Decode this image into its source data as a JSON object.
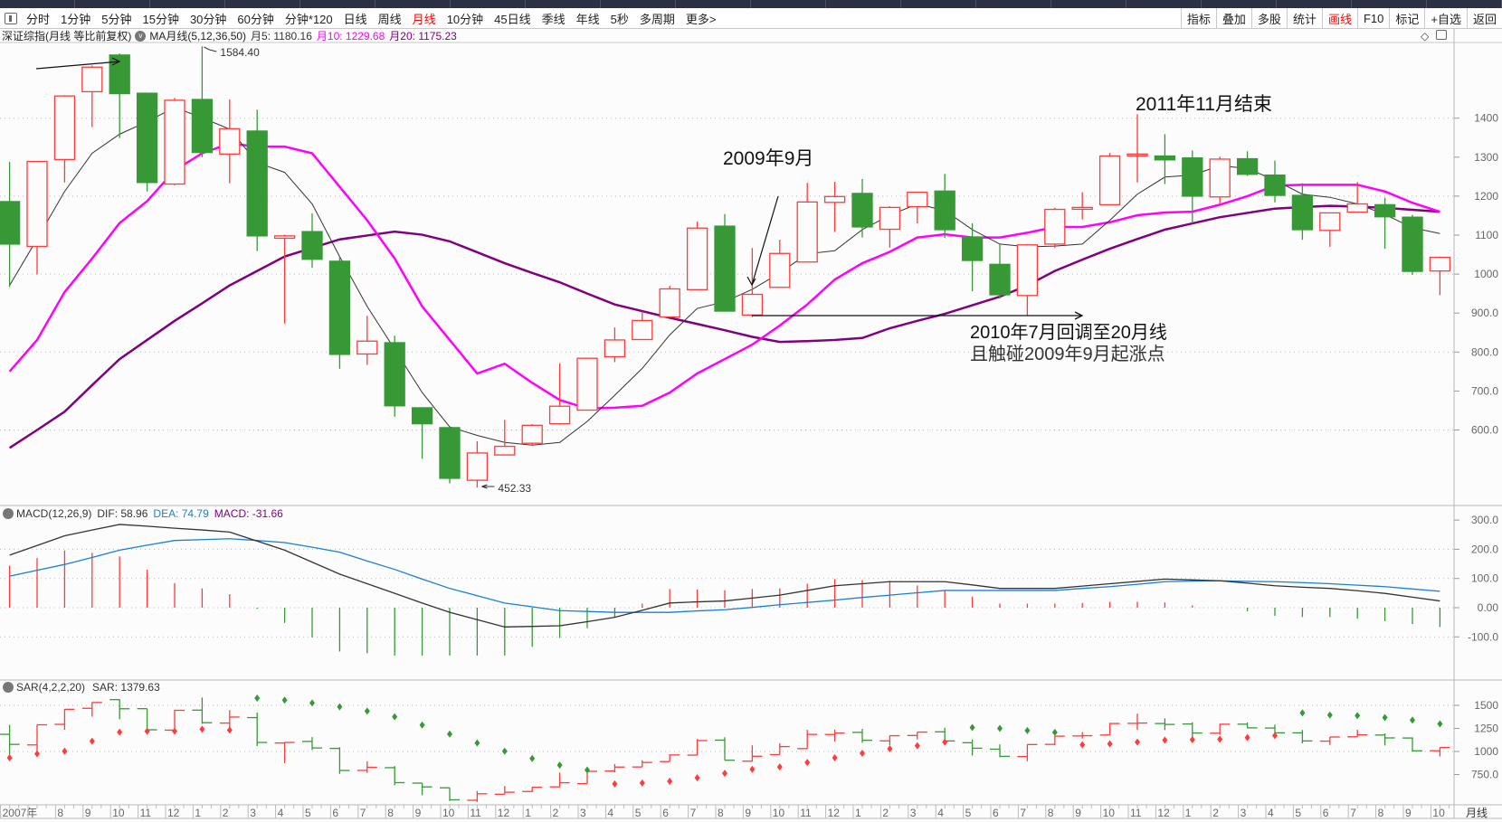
{
  "toolbar": {
    "periods": [
      "分时",
      "1分钟",
      "5分钟",
      "15分钟",
      "30分钟",
      "60分钟",
      "分钟*120",
      "日线",
      "周线",
      "月线",
      "10分钟",
      "45日线",
      "季线",
      "年线",
      "5秒",
      "多周期",
      "更多>"
    ],
    "active_period": "月线",
    "right_buttons": [
      "指标",
      "叠加",
      "多股",
      "统计",
      "画线",
      "F10",
      "标记",
      "+自选",
      "返回"
    ],
    "active_right": "画线"
  },
  "header": {
    "title": "深证综指(月线 等比前复权)",
    "ma_label": "MA月线(5,12,36,50)",
    "ma5": "月5: 1180.16",
    "ma10": "月10: 1229.68",
    "ma20": "月20: 1175.23",
    "diamond_icon": "◇"
  },
  "colors": {
    "up": "#ff3b3b",
    "down": "#369936",
    "ma5": "#333333",
    "ma10": "#ff00ff",
    "ma20": "#800080",
    "dif": "#333333",
    "dea": "#1a7fd4",
    "macd_label": "#800080"
  },
  "chart_data": {
    "type": "candlestick",
    "title": "深证综指(月线 等比前复权)",
    "x_start": "2007-06",
    "x_labels": [
      "2007年",
      "",
      "8",
      "9",
      "10",
      "11",
      "12",
      "1",
      "2",
      "3",
      "4",
      "5",
      "6",
      "7",
      "8",
      "9",
      "10",
      "11",
      "12",
      "1",
      "2",
      "3",
      "4",
      "5",
      "6",
      "7",
      "8",
      "9",
      "10",
      "11",
      "12",
      "1",
      "2",
      "3",
      "4",
      "5",
      "6",
      "7",
      "8",
      "9",
      "10",
      "11",
      "12",
      "1",
      "2",
      "3",
      "4",
      "5",
      "6",
      "7",
      "8",
      "9",
      "10"
    ],
    "period_label": "月线",
    "price_axis": {
      "ticks": [
        "1400",
        "1300",
        "1200",
        "1100",
        "1000",
        "900.0",
        "800.0",
        "700.0",
        "600.0"
      ],
      "values": [
        1400,
        1300,
        1200,
        1100,
        1000,
        900,
        800,
        700,
        600
      ]
    },
    "ohlc": [
      [
        1186,
        1288,
        967,
        1077
      ],
      [
        1071,
        1290,
        999,
        1289
      ],
      [
        1294,
        1459,
        1235,
        1457
      ],
      [
        1468,
        1535,
        1377,
        1531
      ],
      [
        1562,
        1566,
        1349,
        1463
      ],
      [
        1464,
        1464,
        1212,
        1235
      ],
      [
        1231,
        1452,
        1228,
        1446
      ],
      [
        1448,
        1584.4,
        1300,
        1312
      ],
      [
        1308,
        1448,
        1233,
        1373
      ],
      [
        1367,
        1422,
        1059,
        1098
      ],
      [
        1092,
        1101,
        873,
        1098
      ],
      [
        1109,
        1156,
        1016,
        1038
      ],
      [
        1033,
        1046,
        757,
        794
      ],
      [
        795,
        893,
        767,
        828
      ],
      [
        824,
        842,
        634,
        662
      ],
      [
        657,
        657,
        526,
        616
      ],
      [
        606,
        607,
        463,
        476
      ],
      [
        471,
        571,
        452.33,
        541
      ],
      [
        536,
        626,
        536,
        558
      ],
      [
        566,
        615,
        560,
        612
      ],
      [
        616,
        771,
        614,
        661
      ],
      [
        651,
        784,
        651,
        784
      ],
      [
        788,
        863,
        774,
        831
      ],
      [
        832,
        904,
        832,
        881
      ],
      [
        890,
        970,
        890,
        962
      ],
      [
        960,
        1135,
        960,
        1118
      ],
      [
        1123,
        1154,
        905,
        905
      ],
      [
        895,
        1067,
        890,
        948
      ],
      [
        966,
        1088,
        966,
        1053
      ],
      [
        1031,
        1234,
        1030,
        1185
      ],
      [
        1184,
        1237,
        1108,
        1199
      ],
      [
        1207,
        1244,
        1094,
        1121
      ],
      [
        1115,
        1174,
        1068,
        1171
      ],
      [
        1173,
        1210,
        1130,
        1210
      ],
      [
        1213,
        1257,
        1093,
        1114
      ],
      [
        1095,
        1130,
        956,
        1035
      ],
      [
        1025,
        1077,
        937,
        947
      ],
      [
        945,
        1075,
        894,
        1075
      ],
      [
        1077,
        1170,
        1067,
        1166
      ],
      [
        1168,
        1210,
        1140,
        1171
      ],
      [
        1178,
        1311,
        1178,
        1303
      ],
      [
        1305,
        1410,
        1235,
        1308
      ],
      [
        1303,
        1359,
        1231,
        1293
      ],
      [
        1298,
        1317,
        1130,
        1200
      ],
      [
        1198,
        1301,
        1181,
        1295
      ],
      [
        1296,
        1315,
        1252,
        1256
      ],
      [
        1254,
        1291,
        1184,
        1202
      ],
      [
        1202,
        1233,
        1088,
        1114
      ],
      [
        1112,
        1157,
        1070,
        1157
      ],
      [
        1159,
        1236,
        1159,
        1180
      ],
      [
        1178,
        1196,
        1065,
        1147
      ],
      [
        1146,
        1152,
        998,
        1007
      ],
      [
        1008,
        1045,
        946,
        1043
      ]
    ],
    "high_label": "1584.40",
    "low_label": "452.33",
    "ma5": [
      971,
      1090,
      1212,
      1310,
      1359,
      1391,
      1428,
      1401,
      1372,
      1286,
      1261,
      1180,
      1045,
      917,
      807,
      696,
      608,
      586,
      568,
      561,
      568,
      622,
      689,
      758,
      844,
      912,
      929,
      961,
      1003,
      1052,
      1060,
      1114,
      1151,
      1180,
      1163,
      1114,
      1077,
      1070,
      1072,
      1077,
      1138,
      1205,
      1249,
      1254,
      1278,
      1271,
      1241,
      1205,
      1197,
      1180,
      1153,
      1119,
      1104
    ],
    "ma10": [
      750,
      831,
      954,
      1040,
      1131,
      1187,
      1266,
      1310,
      1335,
      1327,
      1327,
      1310,
      1224,
      1138,
      1040,
      917,
      831,
      745,
      770,
      721,
      677,
      655,
      657,
      662,
      696,
      745,
      782,
      819,
      868,
      922,
      986,
      1028,
      1057,
      1094,
      1102,
      1094,
      1094,
      1106,
      1121,
      1121,
      1133,
      1151,
      1158,
      1160,
      1178,
      1200,
      1227,
      1229,
      1229,
      1229,
      1212,
      1183,
      1160
    ],
    "ma20": [
      554,
      600,
      647,
      715,
      782,
      831,
      880,
      925,
      971,
      1008,
      1045,
      1067,
      1089,
      1099,
      1109,
      1101,
      1084,
      1056,
      1028,
      1003,
      979,
      950,
      922,
      905,
      888,
      872,
      856,
      839,
      826,
      828,
      831,
      836,
      861,
      880,
      898,
      920,
      942,
      971,
      1008,
      1037,
      1065,
      1090,
      1114,
      1130,
      1146,
      1157,
      1168,
      1172,
      1175,
      1173,
      1170,
      1165,
      1160
    ],
    "macd": {
      "label": "MACD(12,26,9)",
      "dif_label": "DIF: 58.96",
      "dea_label": "DEA: 74.79",
      "macd_label": "MACD: -31.66",
      "axis_ticks": [
        "300.0",
        "200.0",
        "100.0",
        "0.00",
        "-100.0"
      ],
      "axis_values": [
        300,
        200,
        100,
        0,
        -100
      ],
      "dif": [
        180,
        213,
        246,
        266,
        285,
        279,
        272,
        266,
        259,
        228,
        197,
        156,
        115,
        82,
        49,
        16,
        -16,
        -41,
        -66,
        -64,
        -62,
        -48,
        -33,
        -9,
        16,
        20,
        23,
        33,
        43,
        59,
        75,
        82,
        89,
        89,
        89,
        78,
        66,
        66,
        66,
        74,
        82,
        90,
        98,
        95,
        92,
        84,
        75,
        70,
        66,
        58,
        49,
        36,
        23
      ],
      "dea": [
        108,
        128,
        148,
        172,
        197,
        214,
        230,
        233,
        236,
        230,
        223,
        207,
        190,
        160,
        131,
        98,
        66,
        41,
        16,
        3,
        -10,
        -13,
        -16,
        -16,
        -16,
        -11,
        -7,
        1,
        10,
        18,
        26,
        35,
        43,
        51,
        59,
        59,
        59,
        59,
        59,
        66,
        72,
        80,
        89,
        91,
        92,
        90,
        89,
        86,
        82,
        77,
        72,
        64,
        56
      ]
    },
    "sar": {
      "label": "SAR(4,2,2,20)",
      "value_label": "SAR: 1379.63",
      "axis_ticks": [
        "1500",
        "1250",
        "1000",
        "750.0"
      ],
      "axis_values": [
        1500,
        1250,
        1000,
        750
      ],
      "values": [
        931,
        974,
        1003,
        1111,
        1209,
        1219,
        1219,
        1242,
        1232,
        1578,
        1556,
        1526,
        1484,
        1438,
        1376,
        1287,
        1189,
        1092,
        1003,
        924,
        852,
        799,
        648,
        658,
        677,
        714,
        763,
        806,
        832,
        881,
        931,
        980,
        1030,
        1062,
        1102,
        1260,
        1250,
        1227,
        1207,
        1072,
        1082,
        1102,
        1122,
        1128,
        1132,
        1151,
        1171,
        1418,
        1395,
        1388,
        1368,
        1339,
        1299
      ],
      "trend": [
        "up",
        "up",
        "up",
        "up",
        "up",
        "up",
        "up",
        "up",
        "up",
        "down",
        "down",
        "down",
        "down",
        "down",
        "down",
        "down",
        "down",
        "down",
        "down",
        "down",
        "down",
        "down",
        "up",
        "up",
        "up",
        "up",
        "up",
        "up",
        "up",
        "up",
        "up",
        "up",
        "up",
        "up",
        "up",
        "down",
        "down",
        "down",
        "down",
        "up",
        "up",
        "up",
        "up",
        "up",
        "up",
        "up",
        "up",
        "down",
        "down",
        "down",
        "down",
        "down",
        "down"
      ]
    },
    "annotations": {
      "sep_2009": "2009年9月",
      "jul_2010_line1": "2010年7月回调至20月线",
      "jul_2010_line2": "且触碰2009年9月起涨点",
      "nov_2011": "2011年11月结束"
    }
  }
}
